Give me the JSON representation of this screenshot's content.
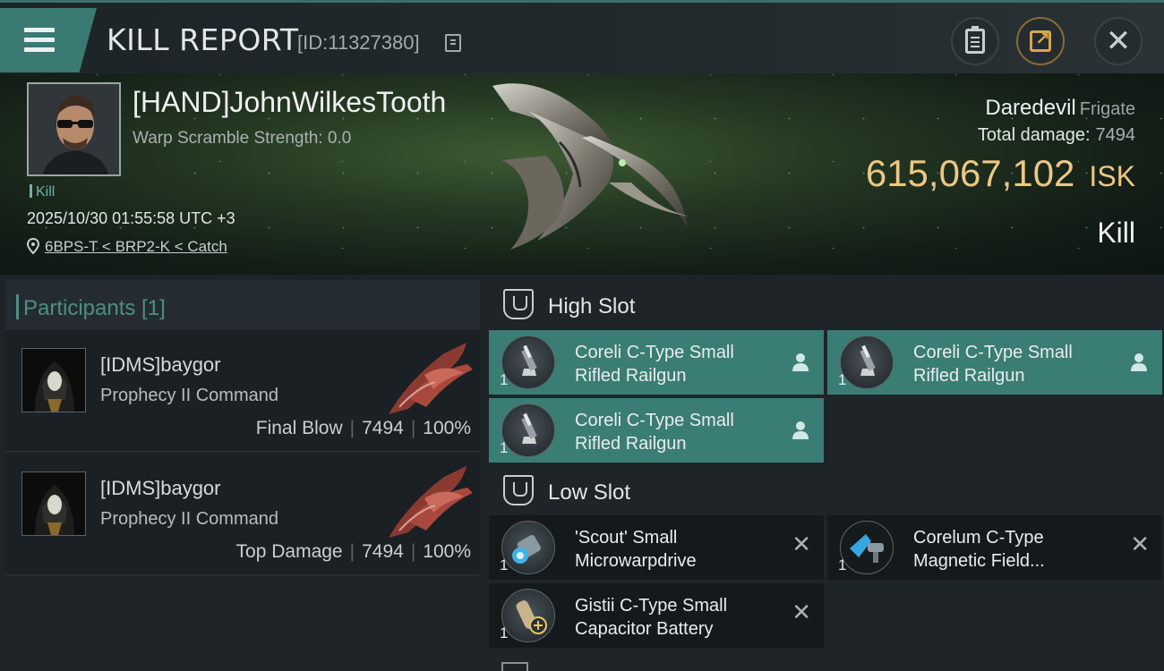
{
  "header": {
    "title": "KILL REPORT",
    "id_text": "[ID:11327380]"
  },
  "victim": {
    "name": "[HAND]JohnWilkesTooth",
    "warp_scramble": "Warp Scramble Strength: 0.0",
    "kill_tag": "Kill",
    "datetime": "2025/10/30 01:55:58 UTC +3",
    "location": "6BPS-T < BRP2-K < Catch",
    "ship_name": "Daredevil",
    "ship_class": "Frigate",
    "total_damage_label": "Total damage:",
    "total_damage": "7494",
    "isk_value": "615,067,102",
    "isk_unit": "ISK",
    "result": "Kill"
  },
  "participants": {
    "label": "Participants [1]",
    "rows": [
      {
        "name": "[IDMS]baygor",
        "ship": "Prophecy II Command",
        "role": "Final Blow",
        "damage": "7494",
        "percent": "100%"
      },
      {
        "name": "[IDMS]baygor",
        "ship": "Prophecy II Command",
        "role": "Top Damage",
        "damage": "7494",
        "percent": "100%"
      }
    ]
  },
  "slots": {
    "high": {
      "label": "High Slot",
      "modules": [
        {
          "qty": "1",
          "name_line1": "Coreli C-Type Small",
          "name_line2": "Rifled Railgun",
          "status": "fitted"
        },
        {
          "qty": "1",
          "name_line1": "Coreli C-Type Small",
          "name_line2": "Rifled Railgun",
          "status": "fitted"
        },
        {
          "qty": "1",
          "name_line1": "Coreli C-Type Small",
          "name_line2": "Rifled Railgun",
          "status": "fitted"
        }
      ]
    },
    "low": {
      "label": "Low Slot",
      "modules": [
        {
          "qty": "1",
          "name_line1": "'Scout' Small",
          "name_line2": "Microwarpdrive",
          "status": "destroyed"
        },
        {
          "qty": "1",
          "name_line1": "Corelum C-Type",
          "name_line2": "Magnetic Field...",
          "status": "destroyed"
        },
        {
          "qty": "1",
          "name_line1": "Gistii C-Type Small",
          "name_line2": "Capacitor Battery",
          "status": "destroyed"
        }
      ]
    }
  },
  "icons": {
    "menu": "hamburger-icon",
    "copy": "copy-icon",
    "clipboard": "clipboard-icon",
    "share": "share-icon",
    "close": "close-icon",
    "location": "location-pin-icon",
    "fitted_status": "person-icon",
    "destroyed_status": "x-icon"
  },
  "colors": {
    "accent_teal": "#3a7d74",
    "isk_gold": "#ecc784",
    "share_gold": "#d9a54a"
  }
}
